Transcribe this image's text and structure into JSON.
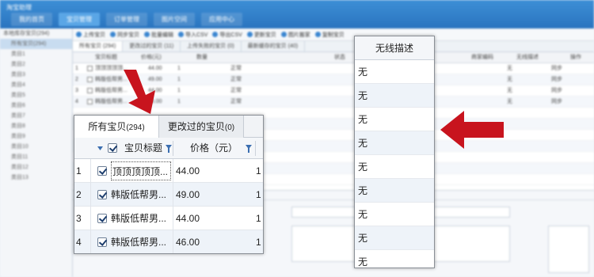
{
  "app": {
    "title": "淘宝助理",
    "nav": [
      "我的首页",
      "宝贝管理",
      "订单管理",
      "图片空间",
      "应用中心"
    ]
  },
  "sidebar": {
    "title": "本地库存宝贝(294)",
    "items": [
      "所有宝贝(294)",
      "类目1",
      "类目2",
      "类目3",
      "类目4",
      "类目5",
      "类目6",
      "类目7",
      "类目8",
      "类目9",
      "类目10",
      "类目11",
      "类目12",
      "类目13"
    ]
  },
  "toolbar": {
    "items": [
      "上传宝贝",
      "同步宝贝",
      "批量编辑",
      "导入CSV",
      "导出CSV",
      "更新宝贝",
      "图片搬家",
      "复制宝贝"
    ]
  },
  "background_tabs": [
    "所有宝贝 (294)",
    "更改过的宝贝 (11)",
    "上传失败的宝贝 (0)",
    "最新缓存的宝贝 (40)"
  ],
  "background_header": {
    "col_title": "宝贝标题",
    "col_price": "价格(元)",
    "col_qty": "数量",
    "col_status": "状态",
    "col_code": "商家编码",
    "col_wireless": "无线描述",
    "col_op": "操作"
  },
  "background_rows": [
    {
      "n": "1",
      "title": "顶顶顶顶顶...",
      "price": "44.00",
      "qty": "1",
      "status": "正常",
      "wireless": "无",
      "op": "同步"
    },
    {
      "n": "2",
      "title": "韩版低帮男...",
      "price": "49.00",
      "qty": "1",
      "status": "正常",
      "wireless": "无",
      "op": "同步"
    },
    {
      "n": "3",
      "title": "韩版低帮男...",
      "price": "44.00",
      "qty": "1",
      "status": "正常",
      "wireless": "无",
      "op": "同步"
    },
    {
      "n": "4",
      "title": "韩版低帮男...",
      "price": "46.00",
      "qty": "1",
      "status": "正常",
      "wireless": "无",
      "op": "同步"
    }
  ],
  "zoom_left": {
    "tabs": [
      {
        "label": "所有宝贝",
        "count": "(294)"
      },
      {
        "label": "更改过的宝贝",
        "count": "(0)"
      }
    ],
    "header": {
      "title": "宝贝标题",
      "price": "价格（元）"
    },
    "rows": [
      {
        "n": "1",
        "title": "顶顶顶顶顶...",
        "price": "44.00",
        "qty": "1"
      },
      {
        "n": "2",
        "title": "韩版低帮男...",
        "price": "49.00",
        "qty": "1"
      },
      {
        "n": "3",
        "title": "韩版低帮男...",
        "price": "44.00",
        "qty": "1"
      },
      {
        "n": "4",
        "title": "韩版低帮男...",
        "price": "46.00",
        "qty": "1"
      }
    ]
  },
  "zoom_right": {
    "header": "无线描述",
    "cells": [
      "无",
      "无",
      "无",
      "无",
      "无",
      "无",
      "无",
      "无",
      "无"
    ]
  },
  "colors": {
    "arrow": "#c8141e",
    "topbar": "#2f7bc5",
    "selected_row": "#eef3f9"
  },
  "icons": [
    "checkbox-icon",
    "filter-icon",
    "sort-caret-icon",
    "red-arrow-down-icon",
    "red-arrow-left-icon"
  ]
}
